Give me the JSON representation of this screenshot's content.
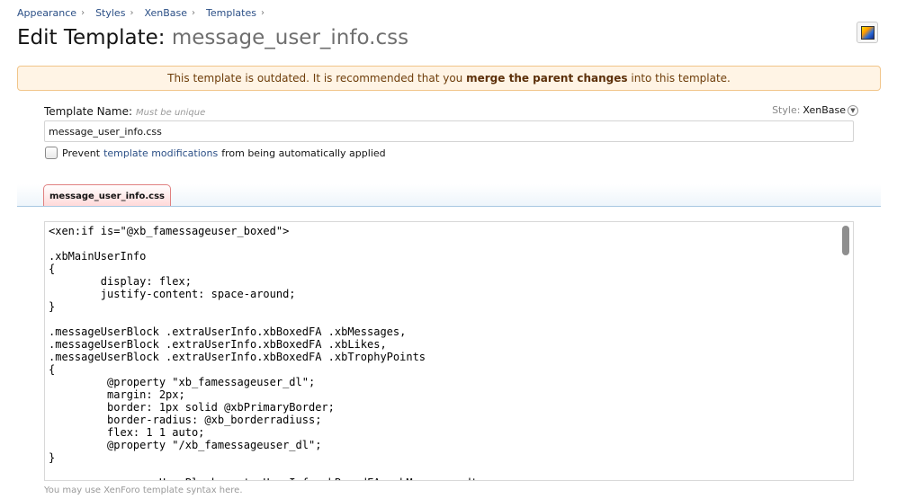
{
  "breadcrumb": [
    {
      "label": "Appearance"
    },
    {
      "label": "Styles"
    },
    {
      "label": "XenBase"
    },
    {
      "label": "Templates"
    }
  ],
  "page": {
    "title_prefix": "Edit Template:",
    "template_name": "message_user_info.css"
  },
  "style_icon": "style-properties-icon",
  "notice": {
    "text_before": "This template is outdated. It is recommended that you",
    "bold": "merge the parent changes",
    "text_after": "into this template."
  },
  "form": {
    "name_label": "Template Name:",
    "name_hint": "Must be unique",
    "style_label": "Style:",
    "style_value": "XenBase",
    "name_value": "message_user_info.css",
    "checkbox_prefix": "Prevent",
    "checkbox_link": "template modifications",
    "checkbox_suffix": "from being automatically applied",
    "checkbox_checked": false
  },
  "tab": {
    "label": "message_user_info.css"
  },
  "editor": {
    "code": "<xen:if is=\"@xb_famessageuser_boxed\">\n\n.xbMainUserInfo\n{\n\tdisplay: flex;\n\tjustify-content: space-around;\n}\n\n.messageUserBlock .extraUserInfo.xbBoxedFA .xbMessages,\n.messageUserBlock .extraUserInfo.xbBoxedFA .xbLikes,\n.messageUserBlock .extraUserInfo.xbBoxedFA .xbTrophyPoints\n{\n\t @property \"xb_famessageuser_dl\";\n\t margin: 2px;\n\t border: 1px solid @xbPrimaryBorder;\n\t border-radius: @xb_borderradiuss;\n\t flex: 1 1 auto;\n\t @property \"/xb_famessageuser_dl\";\n}\n\n\t .messageUserBlock .extraUserInfo.xbBoxedFA .xbMessages dt,"
  },
  "helper_text": "You may use XenForo template syntax here."
}
